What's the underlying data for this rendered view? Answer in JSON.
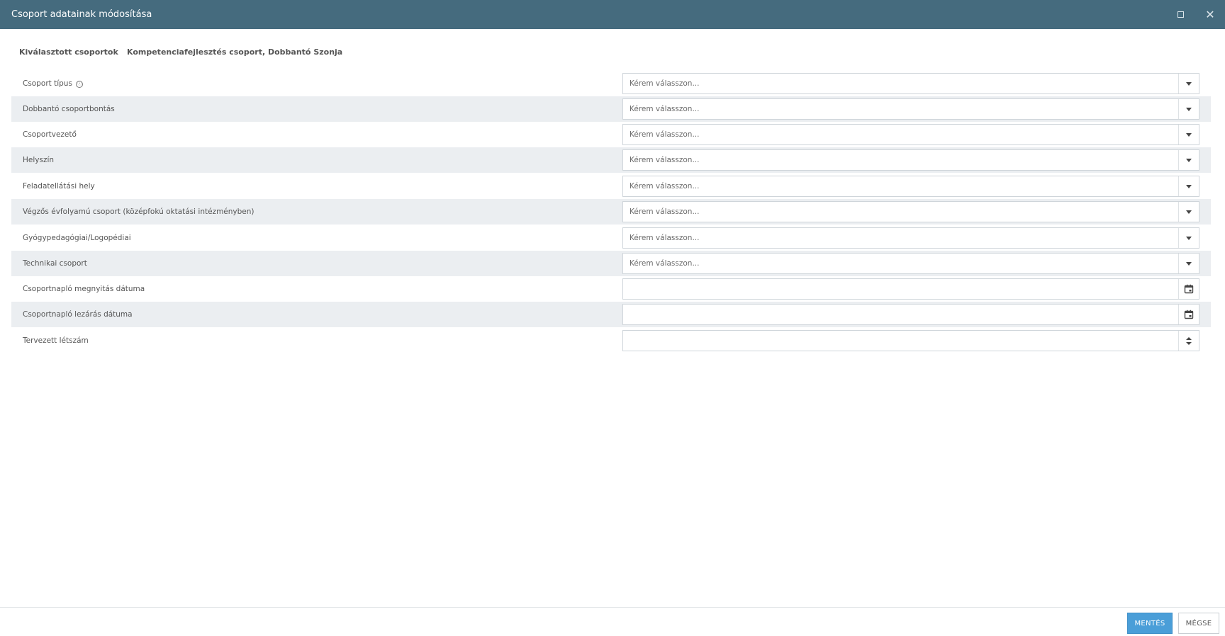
{
  "window": {
    "title": "Csoport adatainak módosítása",
    "maximize_icon": "maximize-icon",
    "close_icon": "close-icon",
    "accent_color": "#456b7e"
  },
  "selected": {
    "label": "Kiválasztott csoportok",
    "value": "Kompetenciafejlesztés csoport, Dobbantó Szonja"
  },
  "form": {
    "fields": [
      {
        "label": "Csoport típus",
        "type": "select",
        "placeholder": "Kérem válasszon...",
        "info_icon": "ⓘ"
      },
      {
        "label": "Dobbantó csoportbontás",
        "type": "select",
        "placeholder": "Kérem válasszon..."
      },
      {
        "label": "Csoportvezető",
        "type": "select",
        "placeholder": "Kérem válasszon..."
      },
      {
        "label": "Helyszín",
        "type": "select",
        "placeholder": "Kérem válasszon..."
      },
      {
        "label": "Feladatellátási hely",
        "type": "select",
        "placeholder": "Kérem válasszon..."
      },
      {
        "label": "Végzős évfolyamú csoport (középfokú oktatási intézményben)",
        "type": "select",
        "placeholder": "Kérem válasszon..."
      },
      {
        "label": "Gyógypedagógiai/Logopédiai",
        "type": "select",
        "placeholder": "Kérem válasszon..."
      },
      {
        "label": "Technikai csoport",
        "type": "select",
        "placeholder": "Kérem válasszon..."
      },
      {
        "label": "Csoportnapló megnyitás dátuma",
        "type": "date",
        "value": ""
      },
      {
        "label": "Csoportnapló lezárás dátuma",
        "type": "date",
        "value": ""
      },
      {
        "label": "Tervezett létszám",
        "type": "number",
        "value": ""
      }
    ]
  },
  "footer": {
    "save_label": "MENTÉS",
    "cancel_label": "MÉGSE",
    "save_color": "#4a9ed8"
  }
}
